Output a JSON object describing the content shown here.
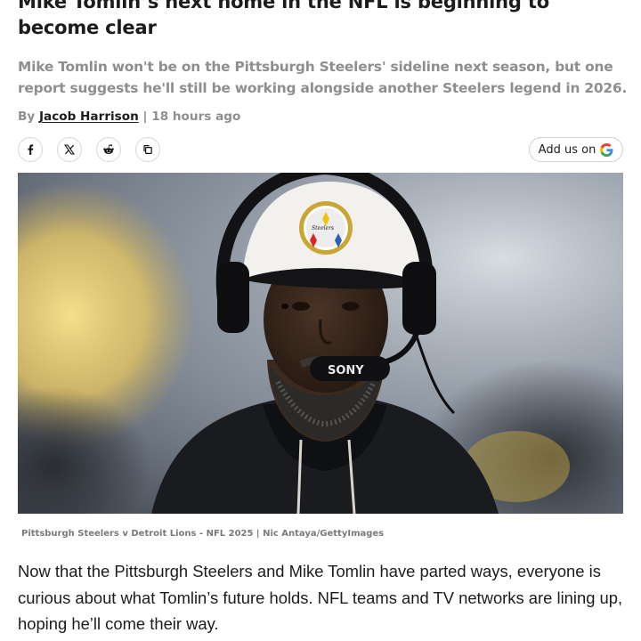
{
  "article": {
    "headline": "Mike Tomlin’s next home in the NFL is beginning to become clear",
    "subheadline": "Mike Tomlin won't be on the Pittsburgh Steelers' sideline next season, but one report suggests he'll still be working alongside another Steelers legend in 2026.",
    "byline": {
      "prefix": "By",
      "author": "Jacob Harrison",
      "separator": "|",
      "timestamp": "18 hours ago"
    },
    "share_buttons": [
      {
        "icon": "facebook-icon"
      },
      {
        "icon": "x-icon"
      },
      {
        "icon": "reddit-icon"
      },
      {
        "icon": "copy-link-icon"
      }
    ],
    "add_us": {
      "label": "Add us on",
      "logo_icon": "google-icon"
    },
    "image": {
      "cap_text": "Steelers",
      "headset_text": "SONY",
      "caption": "Pittsburgh Steelers v Detroit Lions - NFL 2025 | Nic Antaya/GettyImages"
    },
    "body": "Now that the Pittsburgh Steelers and Mike Tomlin have parted ways, everyone is curious about what Tomlin’s future holds. NFL teams and TV networks are lining up, hoping he’ll come their way."
  }
}
